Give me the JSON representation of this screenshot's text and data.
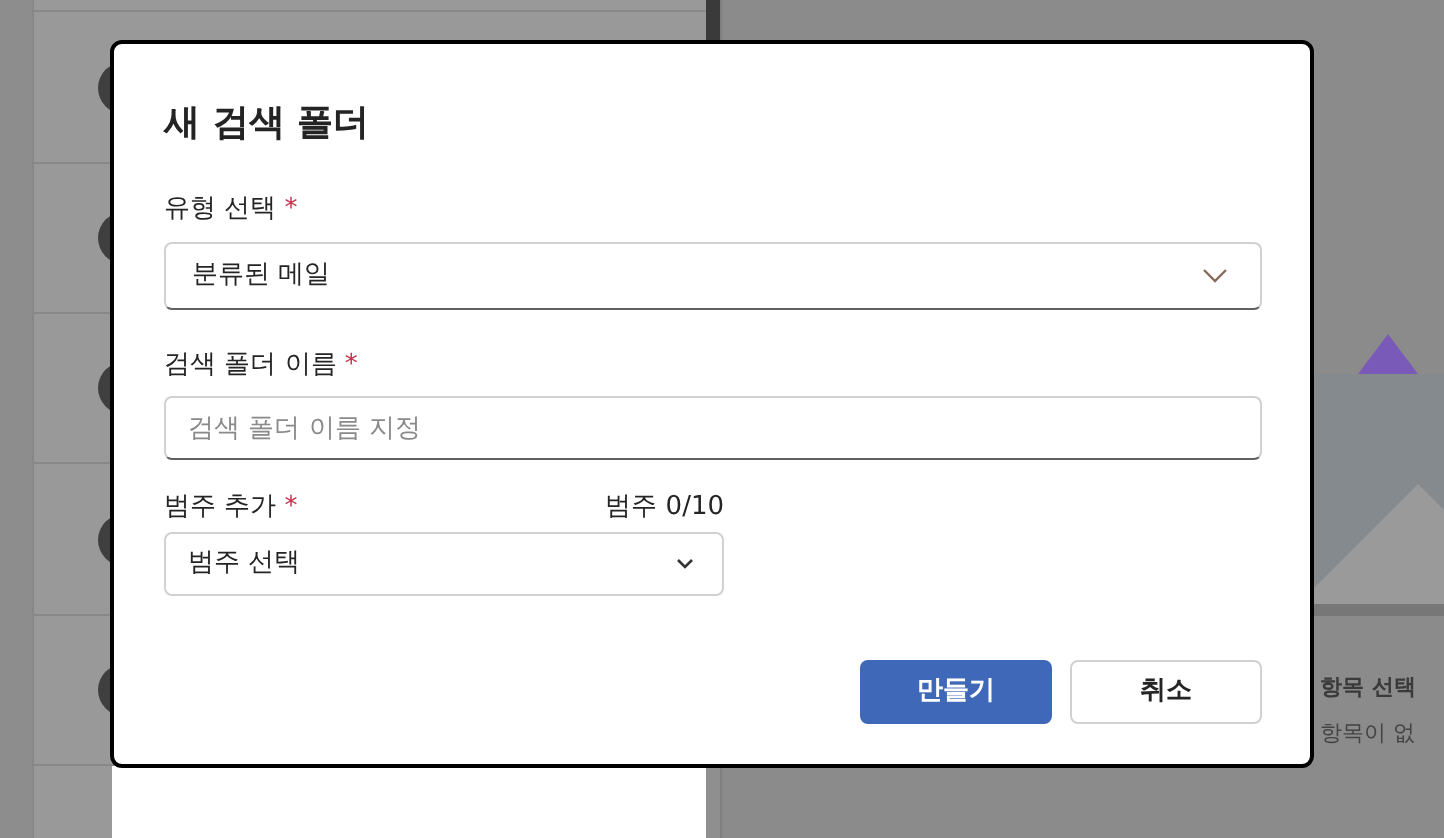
{
  "reading_pane": {
    "empty_title": "항목 선택",
    "empty_subtitle": "항목이 없"
  },
  "dialog": {
    "title": "새 검색 폴더",
    "fields": [
      {
        "kind": "select",
        "label": "유형 선택",
        "required_mark": "*",
        "value": "분류된 메일"
      },
      {
        "kind": "text",
        "label": "검색 폴더 이름",
        "required_mark": "*",
        "placeholder": "검색 폴더 이름 지정"
      },
      {
        "kind": "category",
        "label": "범주 추가",
        "required_mark": "*",
        "counter": "범주 0/10",
        "value": "범주 선택"
      }
    ],
    "buttons": [
      {
        "label": "만들기",
        "primary": true
      },
      {
        "label": "취소",
        "primary": false
      }
    ]
  }
}
